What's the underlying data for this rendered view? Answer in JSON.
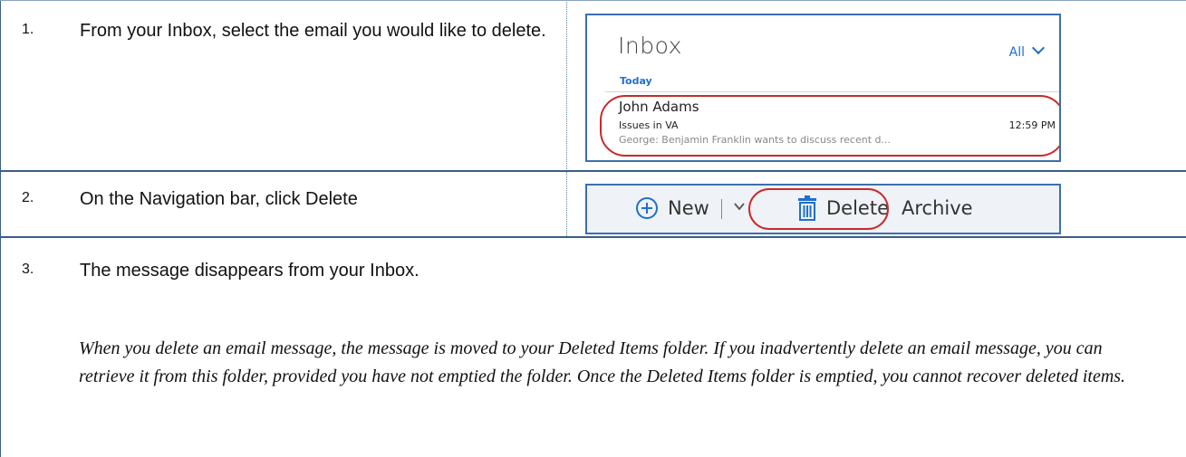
{
  "steps": [
    {
      "number": "1.",
      "text": "From your Inbox, select the email you would like to delete."
    },
    {
      "number": "2.",
      "text": "On the Navigation bar, click Delete"
    },
    {
      "number": "3.",
      "text": "The message disappears from your Inbox."
    }
  ],
  "note": "When you delete an email message, the message is moved to your Deleted Items folder. If you inadvertently delete an email message, you can retrieve it from this folder, provided you have not emptied the folder. Once the Deleted Items folder is emptied, you cannot recover deleted items.",
  "inbox": {
    "title": "Inbox",
    "filter": "All",
    "group": "Today",
    "message": {
      "sender": "John Adams",
      "subject": "Issues in VA",
      "time": "12:59 PM",
      "preview": "George:  Benjamin Franklin wants to discuss recent d..."
    }
  },
  "toolbar": {
    "new_label": "New",
    "delete_label": "Delete",
    "archive_label": "Archive",
    "new_icon": "plus-circle-icon",
    "delete_icon": "trash-icon",
    "dropdown_icon": "chevron-down-icon"
  },
  "colors": {
    "accent": "#1f6fcf",
    "highlight": "#c92a2a",
    "border": "#3b6fb0"
  }
}
